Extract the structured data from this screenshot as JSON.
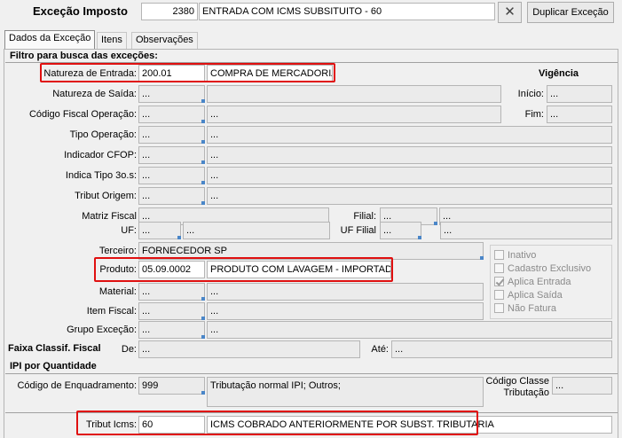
{
  "header": {
    "title": "Exceção Imposto",
    "code": "2380",
    "description": "ENTRADA COM ICMS SUBSITUITO - 60",
    "duplicate_button": "Duplicar Exceção"
  },
  "tabs": [
    {
      "label": "Dados da Exceção",
      "active": true
    },
    {
      "label": "Itens",
      "active": false
    },
    {
      "label": "Observações",
      "active": false
    }
  ],
  "sections": {
    "filter": "Filtro para busca das exceções:",
    "ipi": "IPI por Quantidade",
    "faixa": "Faixa Classif. Fiscal",
    "vigencia": "Vigência"
  },
  "fields": {
    "natureza_entrada": {
      "label": "Natureza de Entrada:",
      "code": "200.01",
      "desc": "COMPRA DE MERCADORIA"
    },
    "natureza_saida": {
      "label": "Natureza de Saída:",
      "code": "...",
      "desc": ""
    },
    "cfop_operacao": {
      "label": "Código Fiscal Operação:",
      "code": "...",
      "desc": "..."
    },
    "tipo_operacao": {
      "label": "Tipo Operação:",
      "code": "...",
      "desc": "..."
    },
    "indicador_cfop": {
      "label": "Indicador CFOP:",
      "code": "...",
      "desc": "..."
    },
    "indica_tipo": {
      "label": "Indica Tipo 3o.s:",
      "code": "...",
      "desc": "..."
    },
    "tribut_origem": {
      "label": "Tribut Origem:",
      "code": "...",
      "desc": "..."
    },
    "matriz_fiscal": {
      "label": "Matriz Fiscal",
      "value": "..."
    },
    "filial": {
      "label": "Filial:",
      "code": "...",
      "desc": "..."
    },
    "uf": {
      "label": "UF:",
      "code": "...",
      "desc": "..."
    },
    "uf_filial": {
      "label": "UF Filial",
      "code": "...",
      "desc": "..."
    },
    "terceiro": {
      "label": "Terceiro:",
      "value": "FORNECEDOR SP"
    },
    "produto": {
      "label": "Produto:",
      "code": "05.09.0002",
      "desc": "PRODUTO COM LAVAGEM - IMPORTADO"
    },
    "material": {
      "label": "Material:",
      "code": "...",
      "desc": "..."
    },
    "item_fiscal": {
      "label": "Item Fiscal:",
      "code": "...",
      "desc": "..."
    },
    "grupo_excecao": {
      "label": "Grupo Exceção:",
      "code": "...",
      "desc": "..."
    },
    "faixa_de": {
      "label": "De:",
      "value": "..."
    },
    "faixa_ate": {
      "label": "Até:",
      "value": "..."
    },
    "inicio": {
      "label": "Início:",
      "value": "..."
    },
    "fim": {
      "label": "Fim:",
      "value": "..."
    },
    "cod_enquadramento": {
      "label": "Código de Enquadramento:",
      "code": "999",
      "desc": "Tributação normal IPI; Outros;"
    },
    "cod_classe": {
      "label_line1": "Código Classe",
      "label_line2": "Tributação",
      "value": "..."
    },
    "tribut_icms": {
      "label": "Tribut Icms:",
      "code": "60",
      "desc": "ICMS COBRADO ANTERIORMENTE POR SUBST. TRIBUTARIA"
    }
  },
  "checkboxes": [
    {
      "label": "Inativo",
      "checked": false
    },
    {
      "label": "Cadastro Exclusivo",
      "checked": false
    },
    {
      "label": "Aplica Entrada",
      "checked": true
    },
    {
      "label": "Aplica Saída",
      "checked": false
    },
    {
      "label": "Não Fatura",
      "checked": false
    }
  ],
  "icons": {
    "clear": "close-icon",
    "lookup": "lookup-handle-icon"
  },
  "colors": {
    "highlight": "#e01010",
    "lookup_handle": "#4a86c8"
  }
}
